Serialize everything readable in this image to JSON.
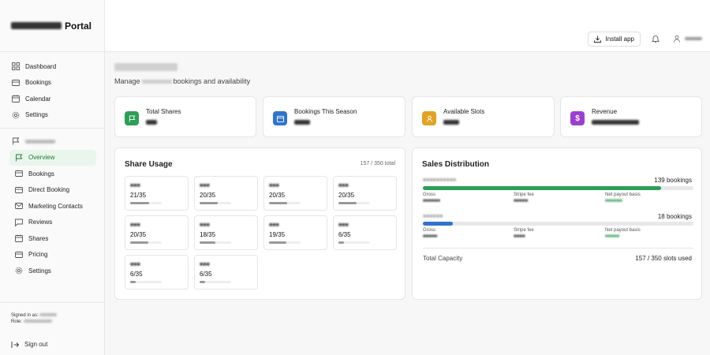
{
  "app": {
    "title_suffix": "Portal"
  },
  "sidebar": {
    "items": [
      {
        "label": "Dashboard",
        "icon": "grid-icon"
      },
      {
        "label": "Bookings",
        "icon": "card-icon"
      },
      {
        "label": "Calendar",
        "icon": "calendar-icon"
      },
      {
        "label": "Settings",
        "icon": "gear-icon"
      }
    ],
    "sub_items": [
      {
        "label": "Overview",
        "icon": "flag-icon",
        "active": true
      },
      {
        "label": "Bookings",
        "icon": "card-icon"
      },
      {
        "label": "Direct Booking",
        "icon": "card-icon"
      },
      {
        "label": "Marketing Contacts",
        "icon": "mail-icon"
      },
      {
        "label": "Reviews",
        "icon": "chat-icon"
      },
      {
        "label": "Shares",
        "icon": "calendar-icon"
      },
      {
        "label": "Pricing",
        "icon": "card-icon"
      },
      {
        "label": "Settings",
        "icon": "gear-icon"
      }
    ],
    "signed_in_label": "Signed in as:",
    "role_label": "Role:",
    "sign_out": "Sign out"
  },
  "topbar": {
    "install_label": "Install app"
  },
  "page": {
    "subtitle_prefix": "Manage",
    "subtitle_suffix": "bookings and availability"
  },
  "stats": [
    {
      "label": "Total Shares",
      "color": "#2e9e57",
      "icon": "flag-icon"
    },
    {
      "label": "Bookings This Season",
      "color": "#2f74d0",
      "icon": "calendar-icon"
    },
    {
      "label": "Available Slots",
      "color": "#e0a324",
      "icon": "users-icon"
    },
    {
      "label": "Revenue",
      "color": "#9a3fd4",
      "icon": "dollar-icon"
    }
  ],
  "share_usage": {
    "title": "Share Usage",
    "total": "157 / 350 total",
    "tiles": [
      {
        "value": "21/35",
        "progress": 0.6
      },
      {
        "value": "20/35",
        "progress": 0.57
      },
      {
        "value": "20/35",
        "progress": 0.57
      },
      {
        "value": "20/35",
        "progress": 0.57
      },
      {
        "value": "20/35",
        "progress": 0.57
      },
      {
        "value": "18/35",
        "progress": 0.51
      },
      {
        "value": "19/35",
        "progress": 0.54
      },
      {
        "value": "6/35",
        "progress": 0.17
      },
      {
        "value": "6/35",
        "progress": 0.17
      },
      {
        "value": "6/35",
        "progress": 0.17
      }
    ]
  },
  "sales": {
    "title": "Sales Distribution",
    "rows": [
      {
        "count": "139 bookings",
        "progress": 0.88,
        "color": "#2e9e57",
        "gross_label": "Gross",
        "fee_label": "Stripe fee",
        "payout_label": "Net payout basis"
      },
      {
        "count": "18 bookings",
        "progress": 0.11,
        "color": "#2f74d0",
        "gross_label": "Gross",
        "fee_label": "Stripe fee",
        "payout_label": "Net payout basis"
      }
    ],
    "capacity_label": "Total Capacity",
    "capacity_value": "157 / 350 slots used"
  }
}
